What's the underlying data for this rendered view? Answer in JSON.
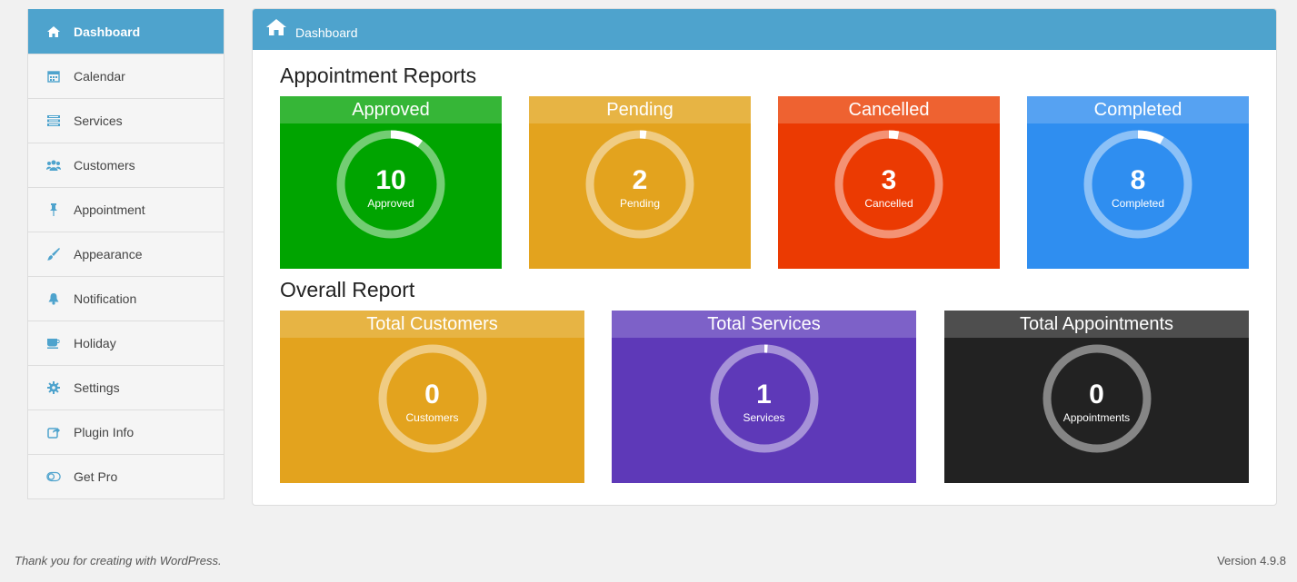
{
  "sidebar": {
    "items": [
      {
        "label": "Dashboard",
        "icon": "home-icon",
        "active": true
      },
      {
        "label": "Calendar",
        "icon": "calendar-icon"
      },
      {
        "label": "Services",
        "icon": "list-icon"
      },
      {
        "label": "Customers",
        "icon": "users-icon"
      },
      {
        "label": "Appointment",
        "icon": "pin-icon"
      },
      {
        "label": "Appearance",
        "icon": "brush-icon"
      },
      {
        "label": "Notification",
        "icon": "bell-icon"
      },
      {
        "label": "Holiday",
        "icon": "cup-icon"
      },
      {
        "label": "Settings",
        "icon": "gear-icon"
      },
      {
        "label": "Plugin Info",
        "icon": "share-icon"
      },
      {
        "label": "Get Pro",
        "icon": "toggle-icon"
      }
    ]
  },
  "panel": {
    "title": "Dashboard",
    "appointment_reports_title": "Appointment Reports",
    "overall_report_title": "Overall Report"
  },
  "appointment_cards": [
    {
      "title": "Approved",
      "value": "10",
      "label": "Approved",
      "fraction": 0.1,
      "body_color": "#00a400",
      "cap_color": "#36b637"
    },
    {
      "title": "Pending",
      "value": "2",
      "label": "Pending",
      "fraction": 0.02,
      "body_color": "#e3a31e",
      "cap_color": "#e7b444"
    },
    {
      "title": "Cancelled",
      "value": "3",
      "label": "Cancelled",
      "fraction": 0.03,
      "body_color": "#eb3a02",
      "cap_color": "#ee6231"
    },
    {
      "title": "Completed",
      "value": "8",
      "label": "Completed",
      "fraction": 0.08,
      "body_color": "#2f8ef0",
      "cap_color": "#56a2f2"
    }
  ],
  "overall_cards": [
    {
      "title": "Total Customers",
      "value": "0",
      "label": "Customers",
      "fraction": 0,
      "body_color": "#e3a31e",
      "cap_color": "#e7b444"
    },
    {
      "title": "Total Services",
      "value": "1",
      "label": "Services",
      "fraction": 0.01,
      "body_color": "#5e39b8",
      "cap_color": "#7d61c8"
    },
    {
      "title": "Total Appointments",
      "value": "0",
      "label": "Appointments",
      "fraction": 0,
      "body_color": "#222222",
      "cap_color": "#4e4e4e"
    }
  ],
  "footer": {
    "left": "Thank you for creating with WordPress.",
    "right": "Version 4.9.8"
  }
}
